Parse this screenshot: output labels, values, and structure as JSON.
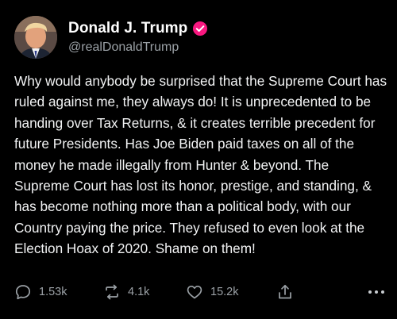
{
  "author": {
    "display_name": "Donald J. Trump",
    "handle": "@realDonaldTrump",
    "verified_icon": "verified-badge-icon",
    "verified_color": "#f91880"
  },
  "post": {
    "text": "Why would anybody be surprised that the Supreme Court has ruled against me, they always do! It is unprecedented to be handing over Tax Returns, & it creates terrible precedent for future Presidents. Has Joe Biden paid taxes on all of the money he made illegally from Hunter & beyond. The Supreme Court has lost its honor, prestige, and standing, & has become nothing more than a political body, with our Country paying the price. They refused to even look at the Election Hoax of 2020. Shame on them!"
  },
  "actions": {
    "replies": "1.53k",
    "reposts": "4.1k",
    "likes": "15.2k",
    "reply_icon": "reply-icon",
    "repost_icon": "repost-icon",
    "like_icon": "heart-icon",
    "share_icon": "share-icon",
    "more_icon": "more-icon"
  },
  "theme": {
    "background": "#000000",
    "text": "#f2f3f4",
    "muted": "#9ba1a6"
  }
}
